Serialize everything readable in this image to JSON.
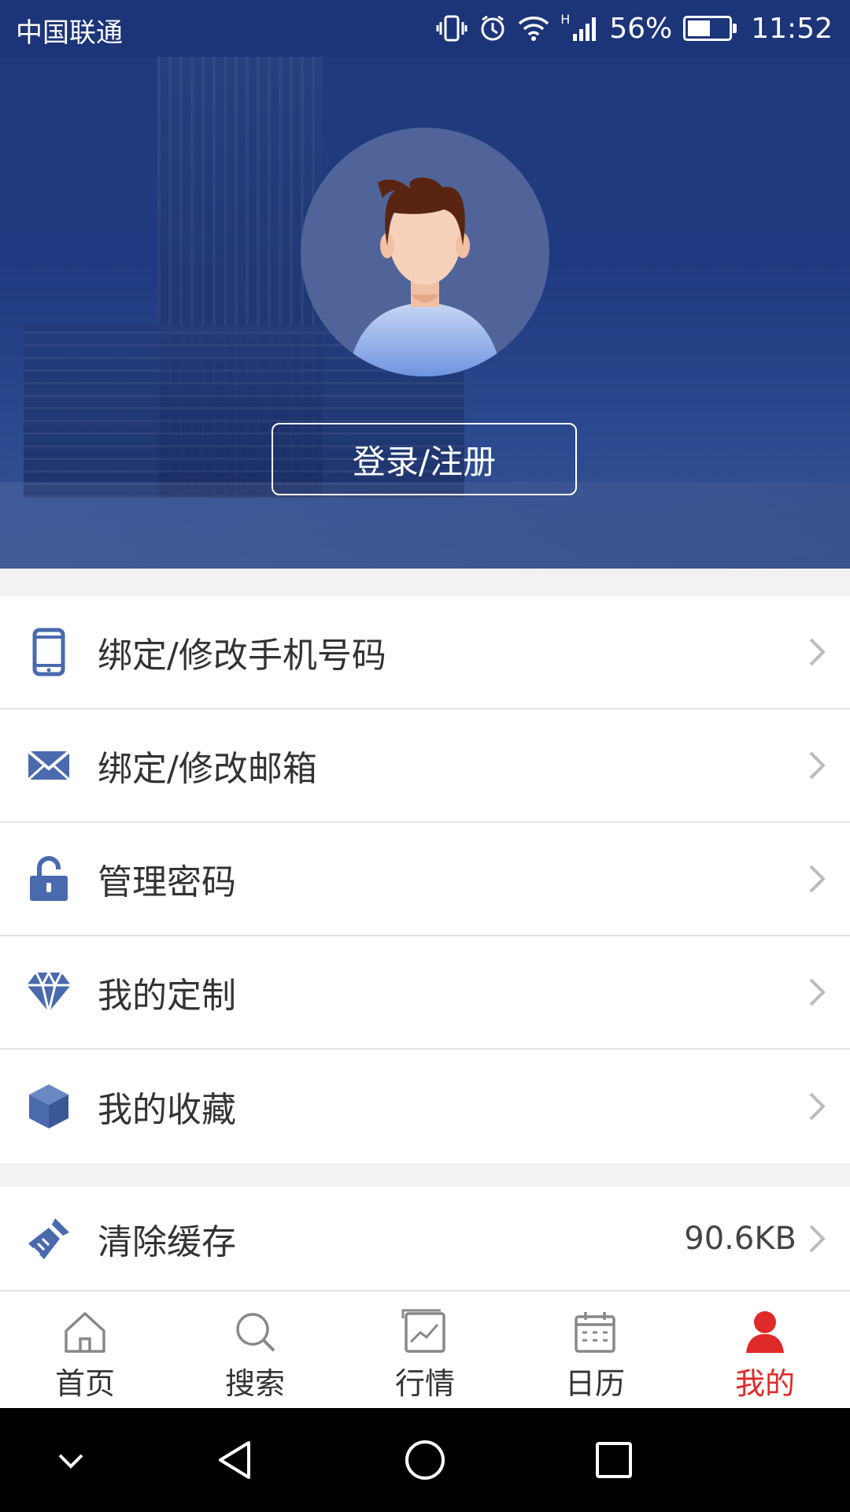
{
  "status_bar": {
    "carrier": "中国联通",
    "signal_type": "H",
    "battery_percent": "56%",
    "battery_level": 0.56,
    "time": "11:52"
  },
  "header": {
    "login_label": "登录/注册"
  },
  "menu_group_1": [
    {
      "icon": "phone-icon",
      "label": "绑定/修改手机号码"
    },
    {
      "icon": "mail-icon",
      "label": "绑定/修改邮箱"
    },
    {
      "icon": "unlock-icon",
      "label": "管理密码"
    },
    {
      "icon": "diamond-icon",
      "label": "我的定制"
    },
    {
      "icon": "cube-icon",
      "label": "我的收藏"
    }
  ],
  "menu_group_2": [
    {
      "icon": "broom-icon",
      "label": "清除缓存",
      "value": "90.6KB"
    }
  ],
  "tabs": [
    {
      "icon": "home-icon",
      "label": "首页",
      "active": false
    },
    {
      "icon": "search-icon",
      "label": "搜索",
      "active": false
    },
    {
      "icon": "market-icon",
      "label": "行情",
      "active": false
    },
    {
      "icon": "calendar-icon",
      "label": "日历",
      "active": false
    },
    {
      "icon": "user-icon",
      "label": "我的",
      "active": true
    }
  ],
  "colors": {
    "header_bg": "#1f3a80",
    "icon_blue": "#4a6aae",
    "active_red": "#e02a2a"
  }
}
